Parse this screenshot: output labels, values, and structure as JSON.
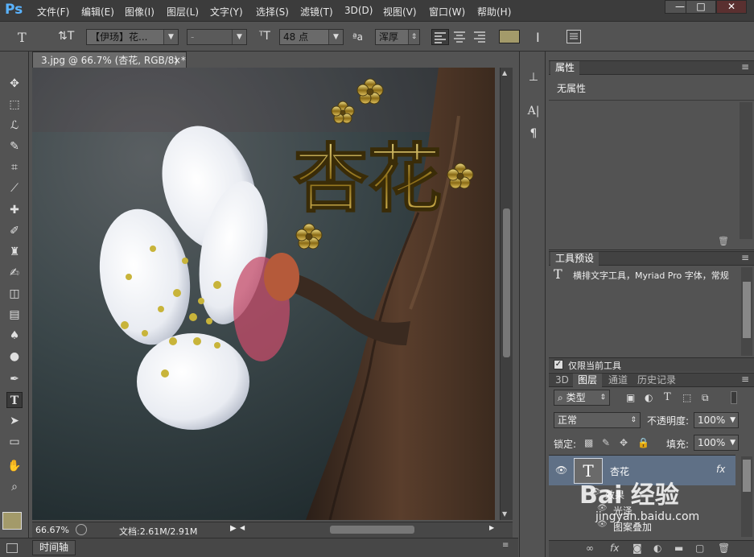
{
  "app": {
    "logo": "Ps"
  },
  "menu": [
    "文件(F)",
    "编辑(E)",
    "图像(I)",
    "图层(L)",
    "文字(Y)",
    "选择(S)",
    "滤镜(T)",
    "3D(D)",
    "视图(V)",
    "窗口(W)",
    "帮助(H)"
  ],
  "window_controls": {
    "minimize": "—",
    "restore": "□",
    "close": "✕"
  },
  "options": {
    "font_family": "【伊玚】花...",
    "font_style": "-",
    "font_size": "48 点",
    "aa_label": "ªa",
    "antialias": "浑厚",
    "text_color": "#a39a6a"
  },
  "document": {
    "tab_title": "3.jpg @ 66.7% (杏花, RGB/8) *",
    "tab_close": "×",
    "overlay_text": "杏花",
    "zoom": "66.67%",
    "doc_size": "文档:2.61M/2.91M"
  },
  "timeline": {
    "label": "时间轴"
  },
  "properties_panel": {
    "title": "属性",
    "content": "无属性"
  },
  "tool_presets_panel": {
    "title": "工具预设",
    "item": "横排文字工具，Myriad Pro 字体，常规",
    "checkbox_label": "仅限当前工具",
    "checked": true
  },
  "layers_panel": {
    "tabs": [
      "3D",
      "图层",
      "通道",
      "历史记录"
    ],
    "active_tab": "图层",
    "filter_type": "类型",
    "blend_mode": "正常",
    "opacity_label": "不透明度:",
    "opacity": "100%",
    "lock_label": "锁定:",
    "fill_label": "填充:",
    "fill": "100%",
    "layer_name": "杏花",
    "layer_fx": "fx",
    "effects_label": "效果",
    "effect1": "光泽",
    "effect2": "图案叠加"
  },
  "watermark": {
    "brand": "Bai 经验",
    "url": "jingyan.baidu.com"
  }
}
